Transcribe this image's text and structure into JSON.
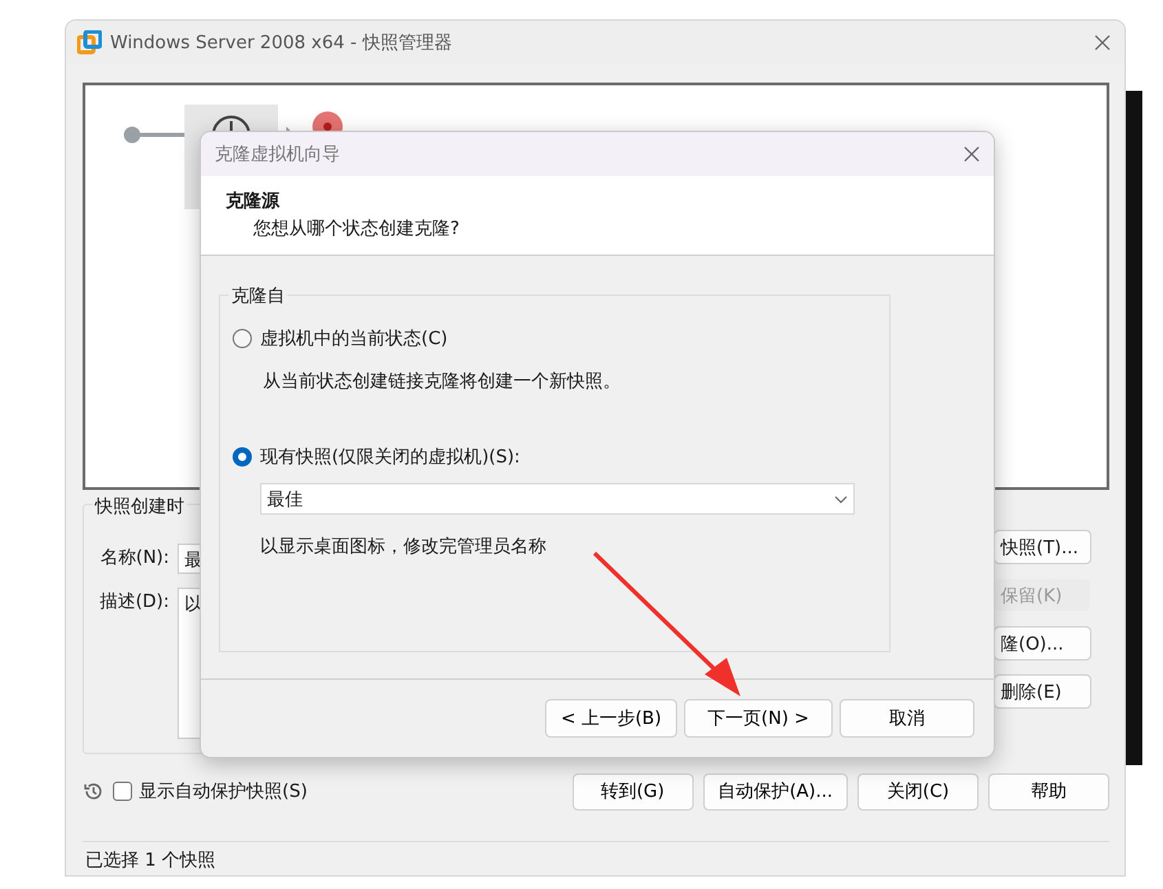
{
  "window": {
    "title": "Windows Server 2008 x64 - 快照管理器"
  },
  "snapshot_group": {
    "label": "快照创建时",
    "name_label": "名称(N):",
    "name_value": "最",
    "description_label": "描述(D):",
    "description_value": "以"
  },
  "side_buttons": [
    {
      "label": "快照(T)...",
      "disabled": false
    },
    {
      "label": "保留(K)",
      "disabled": true
    },
    {
      "label": "隆(O)...",
      "disabled": false
    },
    {
      "label": "删除(E)",
      "disabled": false
    }
  ],
  "auto_protect_checkbox": {
    "label": "显示自动保护快照(S)",
    "checked": false
  },
  "bottom_buttons": [
    "转到(G)",
    "自动保护(A)...",
    "关闭(C)",
    "帮助"
  ],
  "status_bar": "已选择 1 个快照",
  "dialog": {
    "title": "克隆虚拟机向导",
    "heading": "克隆源",
    "subheading": "您想从哪个状态创建克隆?",
    "group_label": "克隆自",
    "options": [
      {
        "label": "虚拟机中的当前状态(C)",
        "selected": false,
        "note": "从当前状态创建链接克隆将创建一个新快照。"
      },
      {
        "label": "现有快照(仅限关闭的虚拟机)(S):",
        "selected": true
      }
    ],
    "snapshot_select": {
      "value": "最佳"
    },
    "snapshot_description": "以显示桌面图标，修改完管理员名称",
    "buttons": [
      "< 上一步(B)",
      "下一页(N) >",
      "取消"
    ]
  }
}
